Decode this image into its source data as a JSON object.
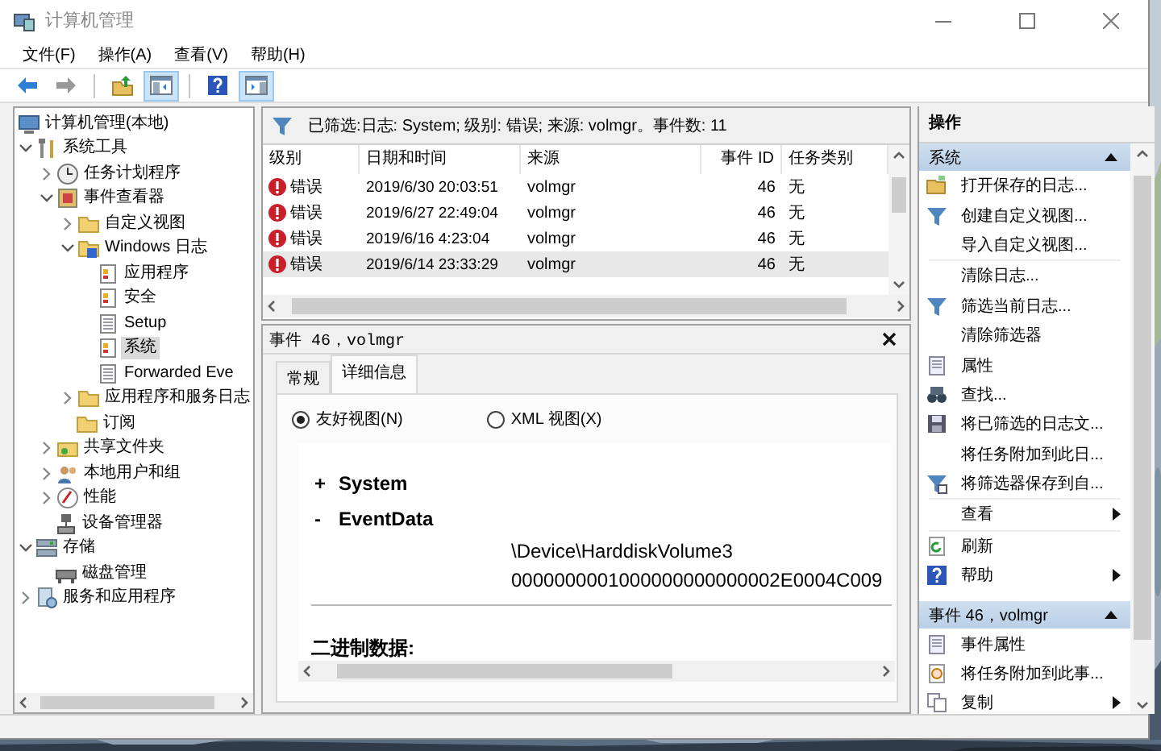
{
  "window": {
    "title": "计算机管理"
  },
  "menu": [
    "文件(F)",
    "操作(A)",
    "查看(V)",
    "帮助(H)"
  ],
  "toolbar": [
    {
      "kind": "back",
      "pressed": false,
      "disabled": false
    },
    {
      "kind": "forward",
      "pressed": false,
      "disabled": true
    },
    {
      "kind": "separator"
    },
    {
      "kind": "up",
      "pressed": false,
      "disabled": false
    },
    {
      "kind": "tree",
      "pressed": true,
      "disabled": false
    },
    {
      "kind": "separator"
    },
    {
      "kind": "help",
      "pressed": false,
      "disabled": false
    },
    {
      "kind": "pane",
      "pressed": true,
      "disabled": false
    }
  ],
  "tree": [
    {
      "label": "计算机管理(本地)",
      "selected": false,
      "children": [
        {
          "label": "系统工具",
          "expanded": true,
          "selected": false,
          "children": [
            {
              "label": "任务计划程序",
              "expanded": false,
              "selected": false
            },
            {
              "label": "事件查看器",
              "expanded": true,
              "selected": false,
              "children": [
                {
                  "label": "自定义视图",
                  "expanded": false,
                  "selected": false
                },
                {
                  "label": "Windows 日志",
                  "expanded": true,
                  "selected": false,
                  "children": [
                    {
                      "label": "应用程序",
                      "selected": false
                    },
                    {
                      "label": "安全",
                      "selected": false
                    },
                    {
                      "label": "Setup",
                      "selected": false
                    },
                    {
                      "label": "系统",
                      "selected": true
                    },
                    {
                      "label": "Forwarded Eve",
                      "selected": false
                    }
                  ]
                },
                {
                  "label": "应用程序和服务日志",
                  "expanded": false,
                  "selected": false
                },
                {
                  "label": "订阅",
                  "selected": false
                }
              ]
            },
            {
              "label": "共享文件夹",
              "expanded": false,
              "selected": false
            },
            {
              "label": "本地用户和组",
              "expanded": false,
              "selected": false
            },
            {
              "label": "性能",
              "expanded": false,
              "selected": false
            },
            {
              "label": "设备管理器",
              "selected": false
            }
          ]
        },
        {
          "label": "存储",
          "expanded": true,
          "selected": false,
          "children": [
            {
              "label": "磁盘管理",
              "selected": false
            }
          ]
        },
        {
          "label": "服务和应用程序",
          "expanded": false,
          "selected": false
        }
      ]
    }
  ],
  "events": {
    "filter": "已筛选:日志: System; 级别: 错误; 来源: volmgr。事件数: 11",
    "columns": [
      "级别",
      "日期和时间",
      "来源",
      "事件 ID",
      "任务类别"
    ],
    "rows": [
      {
        "selected": false,
        "cells": [
          "错误",
          "2019/6/30 20:03:51",
          "volmgr",
          "46",
          "无"
        ]
      },
      {
        "selected": false,
        "cells": [
          "错误",
          "2019/6/27 22:49:04",
          "volmgr",
          "46",
          "无"
        ]
      },
      {
        "selected": false,
        "cells": [
          "错误",
          "2019/6/16 4:23:04",
          "volmgr",
          "46",
          "无"
        ]
      },
      {
        "selected": true,
        "cells": [
          "错误",
          "2019/6/14 23:33:29",
          "volmgr",
          "46",
          "无"
        ]
      }
    ]
  },
  "detail": {
    "title": "事件 46，volmgr",
    "tabs": [
      {
        "label": "常规",
        "selected": false
      },
      {
        "label": "详细信息",
        "selected": true
      }
    ],
    "views": [
      {
        "label": "友好视图(N)",
        "checked": true
      },
      {
        "label": "XML 视图(X)",
        "checked": false
      }
    ],
    "sections": [
      {
        "toggle": "+",
        "label": "System"
      },
      {
        "toggle": "-",
        "label": "EventData",
        "values": [
          "\\Device\\HarddiskVolume3",
          "0000000001000000000000002E0004C009"
        ]
      }
    ],
    "binary_label": "二进制数据:"
  },
  "actions": {
    "title": "操作",
    "sections": [
      {
        "title": "系统",
        "expanded": true,
        "items": [
          {
            "kind": "item",
            "label": "打开保存的日志...",
            "submenu": false
          },
          {
            "kind": "item",
            "label": "创建自定义视图...",
            "submenu": false
          },
          {
            "kind": "item",
            "label": "导入自定义视图...",
            "submenu": false
          },
          {
            "kind": "separator"
          },
          {
            "kind": "item",
            "label": "清除日志...",
            "submenu": false
          },
          {
            "kind": "item",
            "label": "筛选当前日志...",
            "submenu": false
          },
          {
            "kind": "item",
            "label": "清除筛选器",
            "submenu": false
          },
          {
            "kind": "item",
            "label": "属性",
            "submenu": false
          },
          {
            "kind": "item",
            "label": "查找...",
            "submenu": false
          },
          {
            "kind": "item",
            "label": "将已筛选的日志文...",
            "submenu": false
          },
          {
            "kind": "item",
            "label": "将任务附加到此日...",
            "submenu": false
          },
          {
            "kind": "item",
            "label": "将筛选器保存到自...",
            "submenu": false
          },
          {
            "kind": "separator"
          },
          {
            "kind": "item",
            "label": "查看",
            "submenu": true
          },
          {
            "kind": "separator"
          },
          {
            "kind": "item",
            "label": "刷新",
            "submenu": false
          },
          {
            "kind": "item",
            "label": "帮助",
            "submenu": true
          }
        ]
      },
      {
        "title": "事件 46，volmgr",
        "expanded": true,
        "items": [
          {
            "kind": "item",
            "label": "事件属性",
            "submenu": false
          },
          {
            "kind": "item",
            "label": "将任务附加到此事...",
            "submenu": false
          },
          {
            "kind": "item",
            "label": "复制",
            "submenu": true
          }
        ]
      }
    ]
  }
}
